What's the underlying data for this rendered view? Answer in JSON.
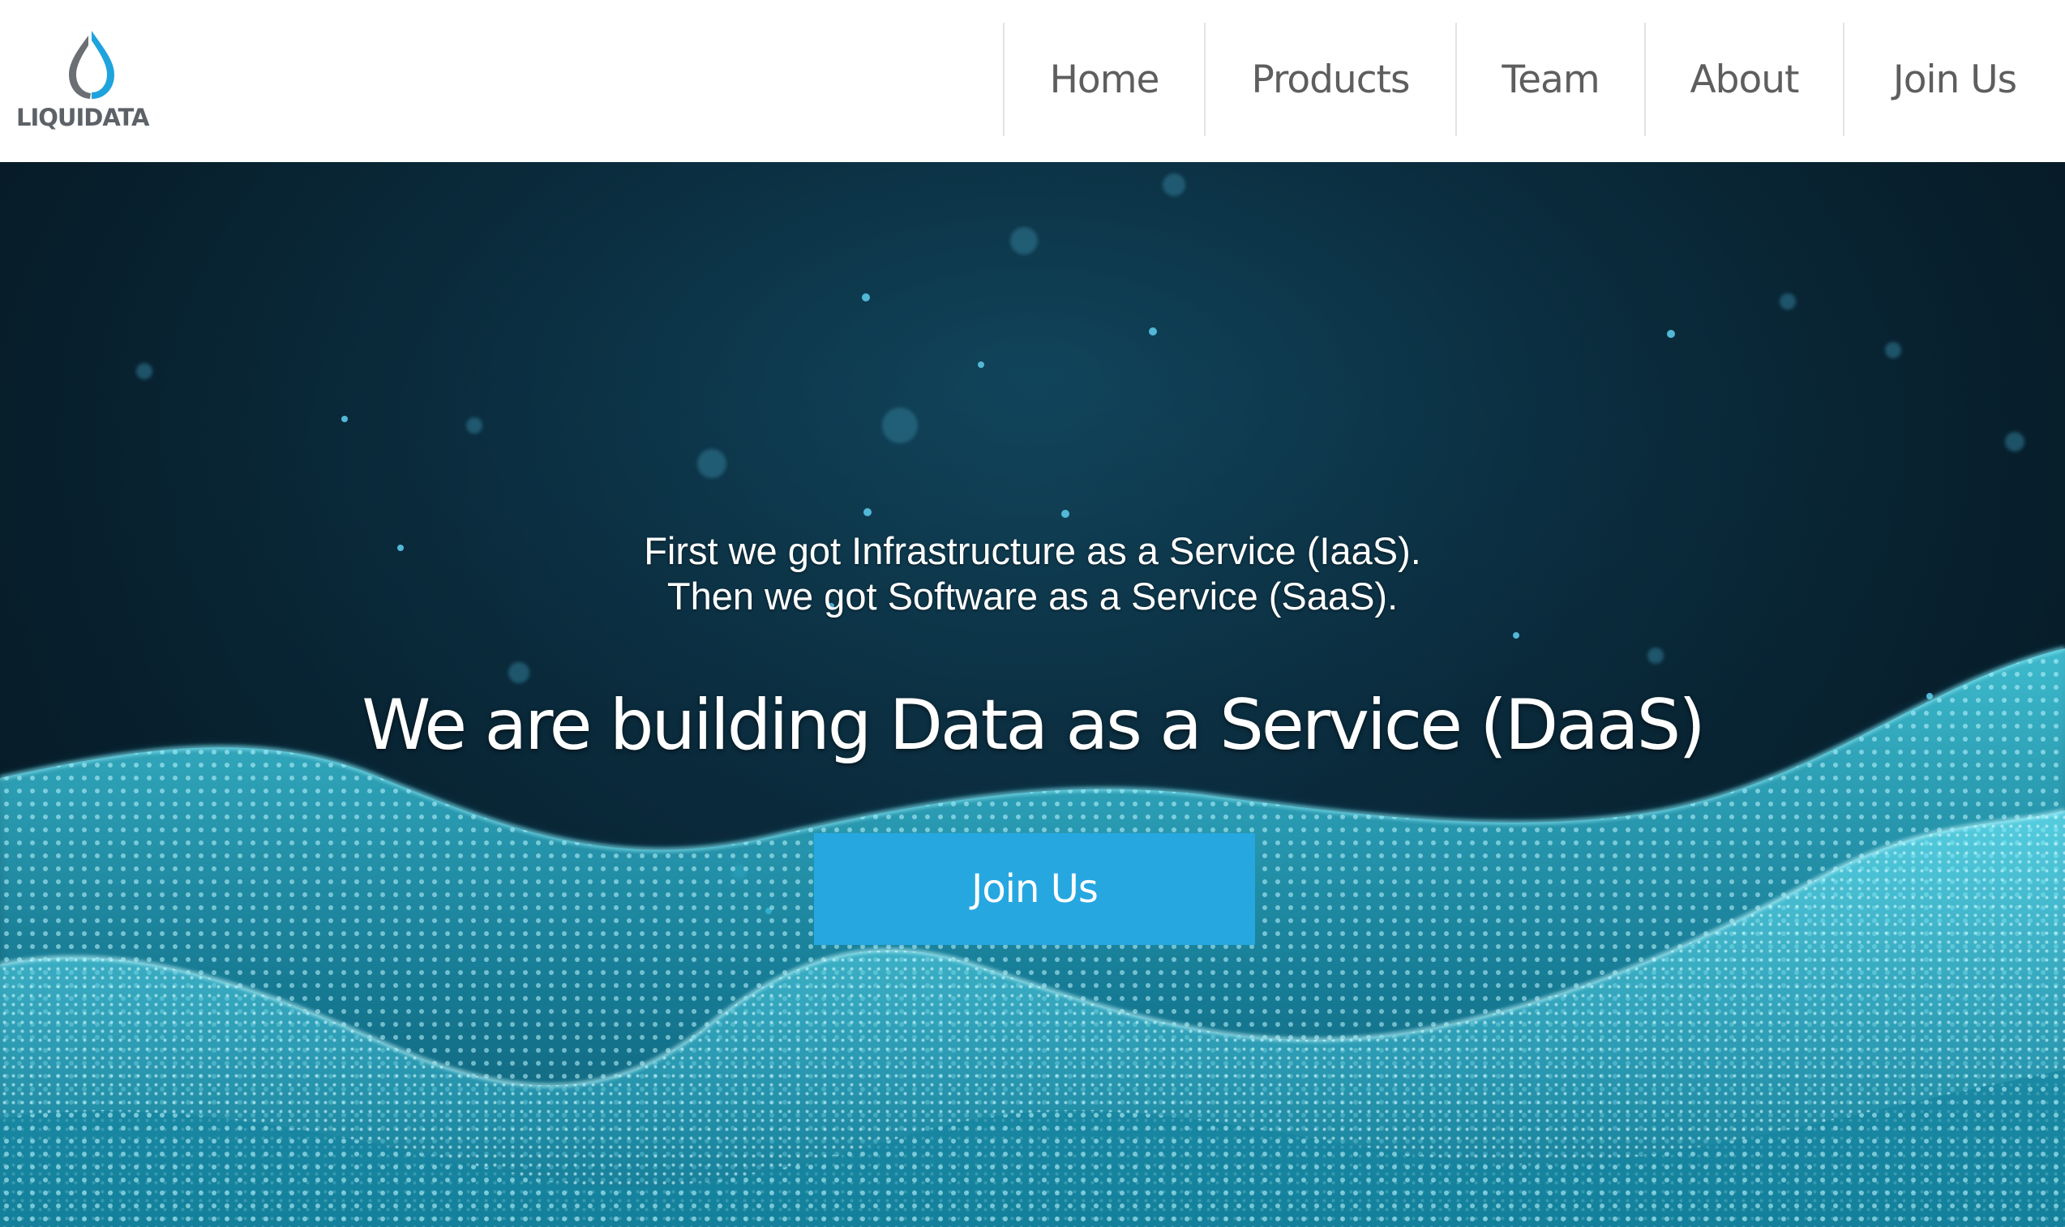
{
  "brand": {
    "name": "LIQUIDATA",
    "logo_icon": "water-drop-icon",
    "colors": {
      "drop_blue": "#1ea3dd",
      "drop_grey": "#6b6f74",
      "text_grey": "#5d6268"
    }
  },
  "nav": {
    "items": [
      {
        "label": "Home"
      },
      {
        "label": "Products"
      },
      {
        "label": "Team"
      },
      {
        "label": "About"
      },
      {
        "label": "Join Us"
      }
    ]
  },
  "hero": {
    "intro_line_1": "First we got Infrastructure as a Service (IaaS).",
    "intro_line_2": "Then we got Software as a Service (SaaS).",
    "headline": "We are building Data as a Service (DaaS)",
    "cta_label": "Join Us",
    "colors": {
      "cta_background": "#26a7e0",
      "background_dark": "#071e2b",
      "wave_cyan": "#3fd6ec"
    }
  }
}
